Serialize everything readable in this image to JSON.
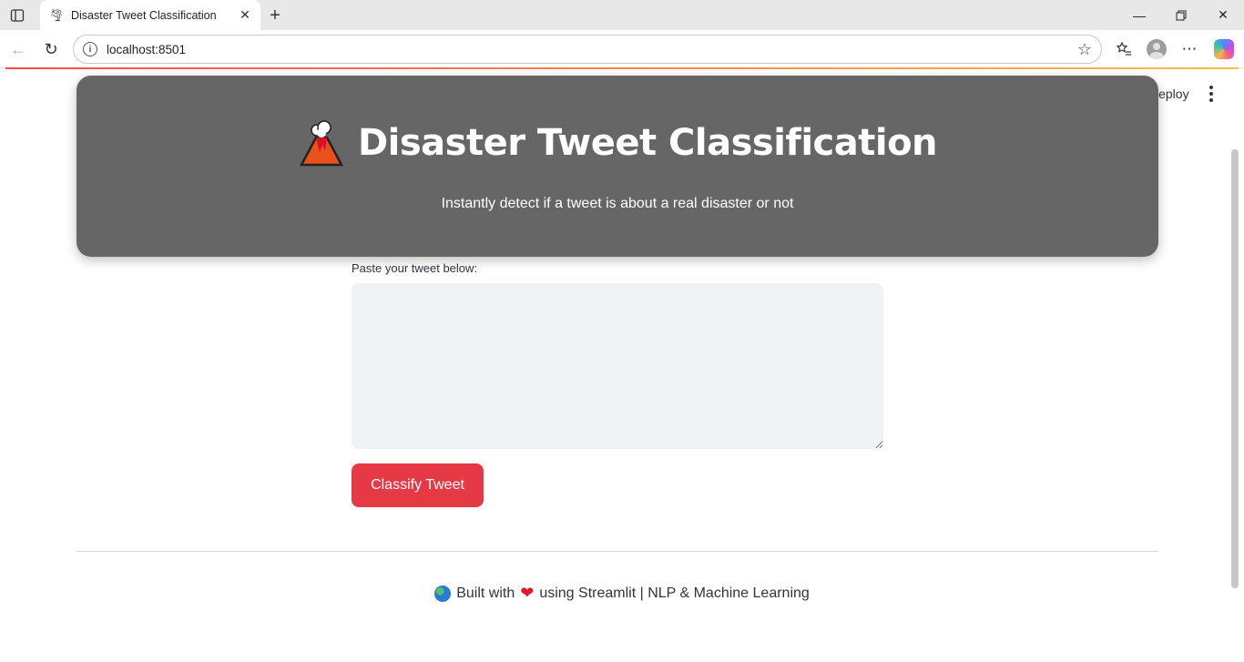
{
  "browser": {
    "tab_title": "Disaster Tweet Classification",
    "url": "localhost:8501"
  },
  "app": {
    "deploy_label": "Deploy",
    "hero_title": "Disaster Tweet Classification",
    "hero_subtitle": "Instantly detect if a tweet is about a real disaster or not",
    "input_label": "Paste your tweet below:",
    "input_value": "",
    "button_label": "Classify Tweet",
    "footer_built_with": "Built with",
    "footer_rest": "using Streamlit | NLP & Machine Learning"
  },
  "colors": {
    "hero_bg": "#666666",
    "button_bg": "#e63946",
    "textarea_bg": "#f0f2f6"
  }
}
